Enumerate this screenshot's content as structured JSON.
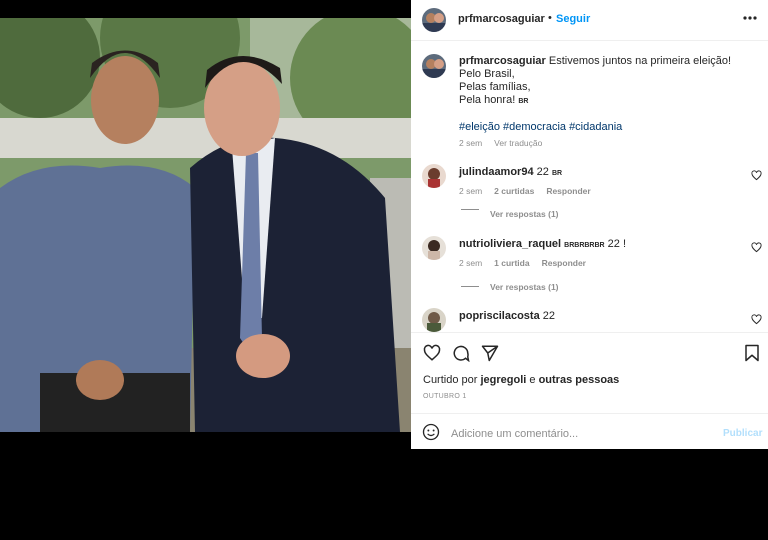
{
  "post": {
    "author": "prfmarcosaguiar",
    "follow_label": "Seguir",
    "caption_lines": [
      "Estivemos juntos na primeira eleição!",
      "Pelo Brasil,",
      "Pelas famílias,",
      "Pela honra!"
    ],
    "flag_badge": "BR",
    "hashtags": "#eleição #democracia #cidadania",
    "age": "2 sem",
    "translate_label": "Ver tradução"
  },
  "comments": [
    {
      "user": "julindaamor94",
      "text": "22",
      "badge": "BR",
      "age": "2 sem",
      "likes": "2 curtidas",
      "reply": "Responder",
      "replies": "Ver respostas (1)"
    },
    {
      "user": "nutrioliviera_raquel",
      "text": "22 !",
      "badge": "BRBRBRBR",
      "age": "2 sem",
      "likes": "1 curtida",
      "reply": "Responder",
      "replies": "Ver respostas (1)"
    },
    {
      "user": "popriscilacosta",
      "text": "22"
    }
  ],
  "likes": {
    "prefix": "Curtido por",
    "user": "jegregoli",
    "conj": "e",
    "others": "outras pessoas"
  },
  "date": "OUTUBRO 1",
  "comment_box": {
    "placeholder": "Adicione um comentário...",
    "publish": "Publicar"
  },
  "icons": [
    "heart-icon",
    "comment-icon",
    "share-icon",
    "bookmark-icon",
    "emoji-icon",
    "more-icon"
  ]
}
